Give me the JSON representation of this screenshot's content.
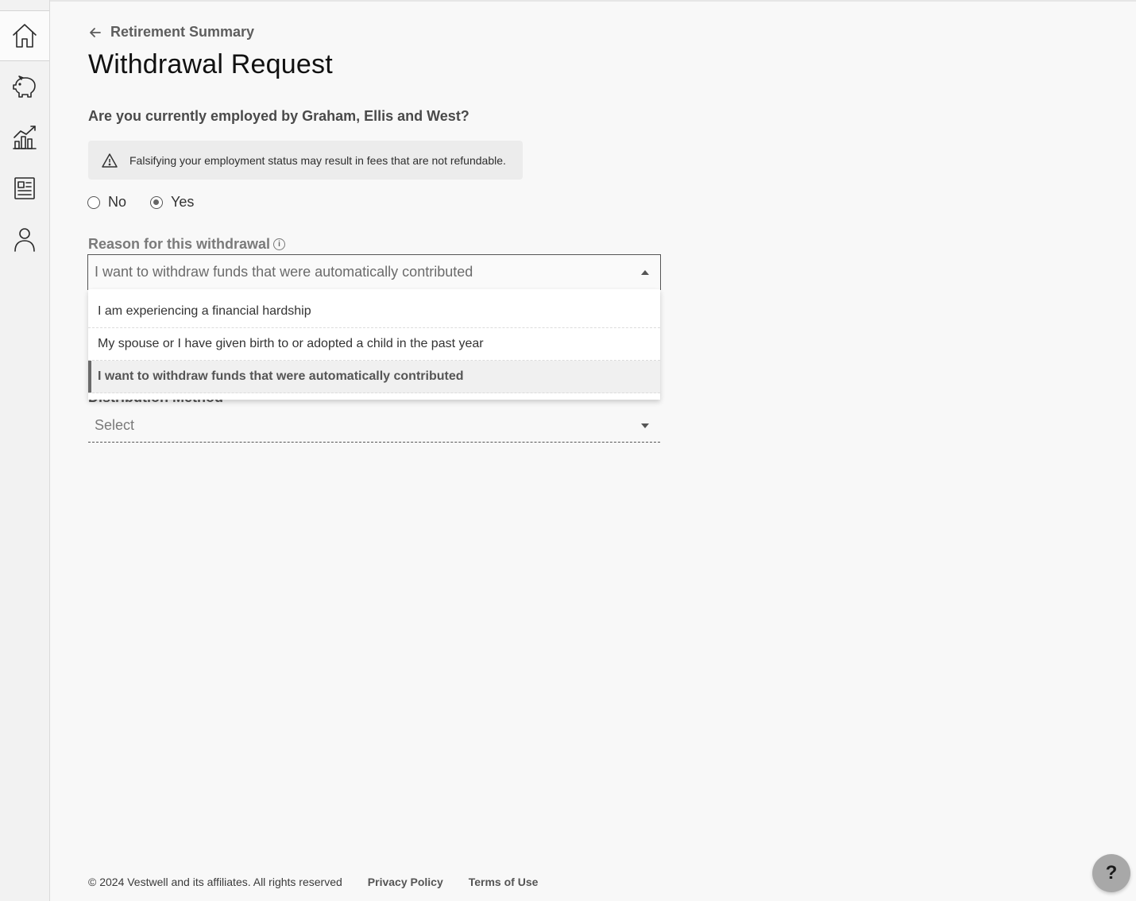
{
  "sidebar": {
    "items": [
      {
        "icon": "home-icon",
        "label": "Home"
      },
      {
        "icon": "piggy-bank-icon",
        "label": "Savings"
      },
      {
        "icon": "chart-icon",
        "label": "Performance"
      },
      {
        "icon": "document-icon",
        "label": "Documents"
      },
      {
        "icon": "user-icon",
        "label": "Profile"
      }
    ]
  },
  "header": {
    "back_label": "Retirement Summary",
    "title": "Withdrawal Request"
  },
  "employment": {
    "question": "Are you currently employed by Graham, Ellis and West?",
    "warning": "Falsifying your employment status may result in fees that are not refundable.",
    "options": [
      "No",
      "Yes"
    ],
    "selected": "Yes"
  },
  "reason": {
    "label": "Reason for this withdrawal",
    "value": "I want to withdraw funds that were automatically contributed",
    "options": [
      "I am experiencing a financial hardship",
      "My spouse or I have given birth to or adopted a child in the past year",
      "I want to withdraw funds that were automatically contributed"
    ]
  },
  "distribution": {
    "label": "Distribution Method",
    "placeholder": "Select"
  },
  "footer": {
    "copyright": "© 2024 Vestwell and its affiliates. All rights reserved",
    "privacy": "Privacy Policy",
    "terms": "Terms of Use"
  },
  "help": {
    "label": "?"
  }
}
